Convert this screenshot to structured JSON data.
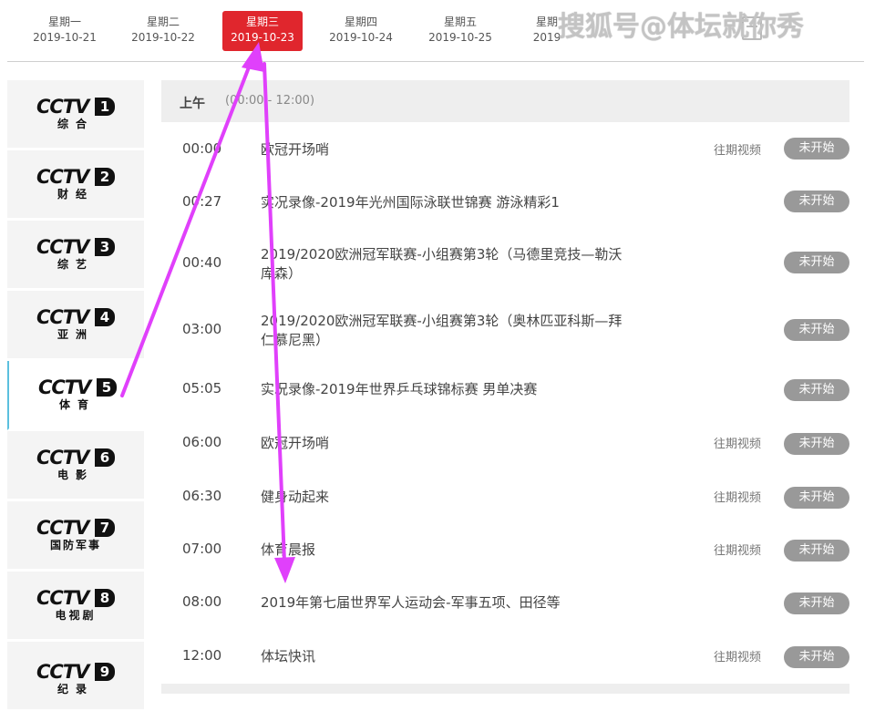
{
  "days": [
    {
      "weekday": "星期一",
      "date": "2019-10-21",
      "active": false
    },
    {
      "weekday": "星期二",
      "date": "2019-10-22",
      "active": false
    },
    {
      "weekday": "星期三",
      "date": "2019-10-23",
      "active": true
    },
    {
      "weekday": "星期四",
      "date": "2019-10-24",
      "active": false
    },
    {
      "weekday": "星期五",
      "date": "2019-10-25",
      "active": false
    },
    {
      "weekday": "星期",
      "date": "2019",
      "active": false
    }
  ],
  "watermark": "搜狐号@体坛就你秀",
  "channels": [
    {
      "brand": "CCTV",
      "num": "1",
      "sub": "综合",
      "active": false
    },
    {
      "brand": "CCTV",
      "num": "2",
      "sub": "财经",
      "active": false
    },
    {
      "brand": "CCTV",
      "num": "3",
      "sub": "综艺",
      "active": false
    },
    {
      "brand": "CCTV",
      "num": "4",
      "sub": "亚洲",
      "active": false
    },
    {
      "brand": "CCTV",
      "num": "5",
      "sub": "体育",
      "active": true
    },
    {
      "brand": "CCTV",
      "num": "6",
      "sub": "电影",
      "active": false
    },
    {
      "brand": "CCTV",
      "num": "7",
      "sub": "国防军事",
      "active": false
    },
    {
      "brand": "CCTV",
      "num": "8",
      "sub": "电视剧",
      "active": false
    },
    {
      "brand": "CCTV",
      "num": "9",
      "sub": "纪录",
      "active": false
    }
  ],
  "schedule": {
    "period_name": "上午",
    "period_range": "(00:00 - 12:00)",
    "rows": [
      {
        "time": "00:00",
        "title": "欧冠开场哨",
        "past": "往期视频",
        "status": "未开始"
      },
      {
        "time": "00:27",
        "title": "实况录像-2019年光州国际泳联世锦赛 游泳精彩1",
        "past": "",
        "status": "未开始"
      },
      {
        "time": "00:40",
        "title": "2019/2020欧洲冠军联赛-小组赛第3轮（马德里竞技—勒沃库森）",
        "past": "",
        "status": "未开始"
      },
      {
        "time": "03:00",
        "title": "2019/2020欧洲冠军联赛-小组赛第3轮（奥林匹亚科斯—拜仁慕尼黑）",
        "past": "",
        "status": "未开始"
      },
      {
        "time": "05:05",
        "title": "实况录像-2019年世界乒乓球锦标赛 男单决赛",
        "past": "",
        "status": "未开始"
      },
      {
        "time": "06:00",
        "title": "欧冠开场哨",
        "past": "往期视频",
        "status": "未开始"
      },
      {
        "time": "06:30",
        "title": "健身动起来",
        "past": "往期视频",
        "status": "未开始"
      },
      {
        "time": "07:00",
        "title": "体育晨报",
        "past": "往期视频",
        "status": "未开始"
      },
      {
        "time": "08:00",
        "title": "2019年第七届世界军人运动会-军事五项、田径等",
        "past": "",
        "status": "未开始"
      },
      {
        "time": "12:00",
        "title": "体坛快讯",
        "past": "往期视频",
        "status": "未开始"
      }
    ]
  },
  "colors": {
    "active_day": "#e0262d",
    "status_badge": "#999999",
    "annotation_arrow": "#e040fb",
    "active_channel_border": "#5bc0de"
  }
}
